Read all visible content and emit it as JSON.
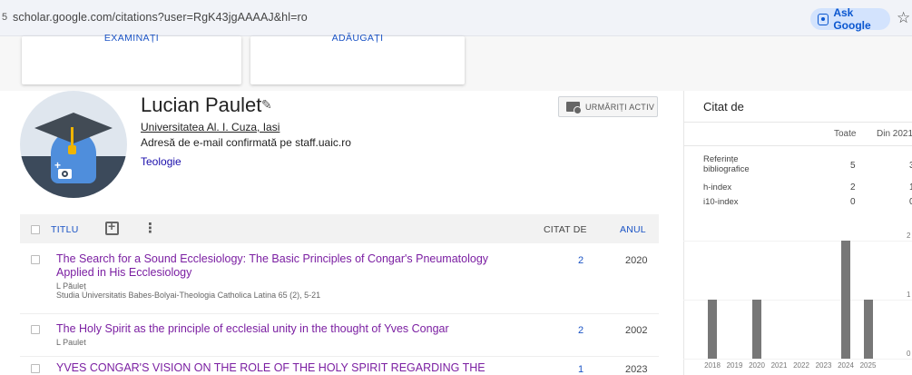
{
  "browser": {
    "url": "scholar.google.com/citations?user=RgK43jgAAAAJ&hl=ro",
    "ask_google": "Ask Google",
    "leading_glyph": "5"
  },
  "top_cards": {
    "card1": "EXAMINAȚI",
    "card2": "ADĂUGAȚI"
  },
  "profile": {
    "name": "Lucian Paulet",
    "affiliation": "Universitatea Al. I. Cuza, Iasi",
    "email": "Adresă de e-mail confirmată pe staff.uaic.ro",
    "interest": "Teologie",
    "follow_label": "URMĂRIȚI ACTIV"
  },
  "table": {
    "col_title": "TITLU",
    "col_cited": "CITAT DE",
    "col_year": "ANUL",
    "rows": [
      {
        "title": "The Search for a Sound Ecclesiology: The Basic Principles of Congar's Pneumatology Applied in His Ecclesiology",
        "authors": "L Păuleț",
        "venue": "Studia Universitatis Babes-Bolyai-Theologia Catholica Latina 65 (2), 5-21",
        "cited": "2",
        "year": "2020"
      },
      {
        "title": "The Holy Spirit as the principle of ecclesial unity in the thought of Yves Congar",
        "authors": "L Paulet",
        "venue": "",
        "cited": "2",
        "year": "2002"
      },
      {
        "title": "YVES CONGAR'S VISION ON THE ROLE OF THE HOLY SPIRIT REGARDING THE",
        "authors": "",
        "venue": "",
        "cited": "1",
        "year": "2023"
      }
    ]
  },
  "cited_by": {
    "heading": "Citat de",
    "col_all": "Toate",
    "col_since": "Din 2021",
    "metrics": [
      {
        "label": "Referințe bibliografice",
        "all": "5",
        "since": "3"
      },
      {
        "label": "h-index",
        "all": "2",
        "since": "1"
      },
      {
        "label": "i10-index",
        "all": "0",
        "since": "0"
      }
    ]
  },
  "chart_data": {
    "type": "bar",
    "categories": [
      "2018",
      "2019",
      "2020",
      "2021",
      "2022",
      "2023",
      "2024",
      "2025"
    ],
    "values": [
      1,
      0,
      1,
      0,
      0,
      0,
      2,
      1
    ],
    "ylim": [
      0,
      2
    ],
    "y_ticks": [
      "2",
      "1",
      "0"
    ],
    "bar_color": "#777777"
  },
  "colors": {
    "link_blue": "#1a53c5",
    "title_purple": "#7b1fa2",
    "ask_bg": "#d3e3fd"
  }
}
